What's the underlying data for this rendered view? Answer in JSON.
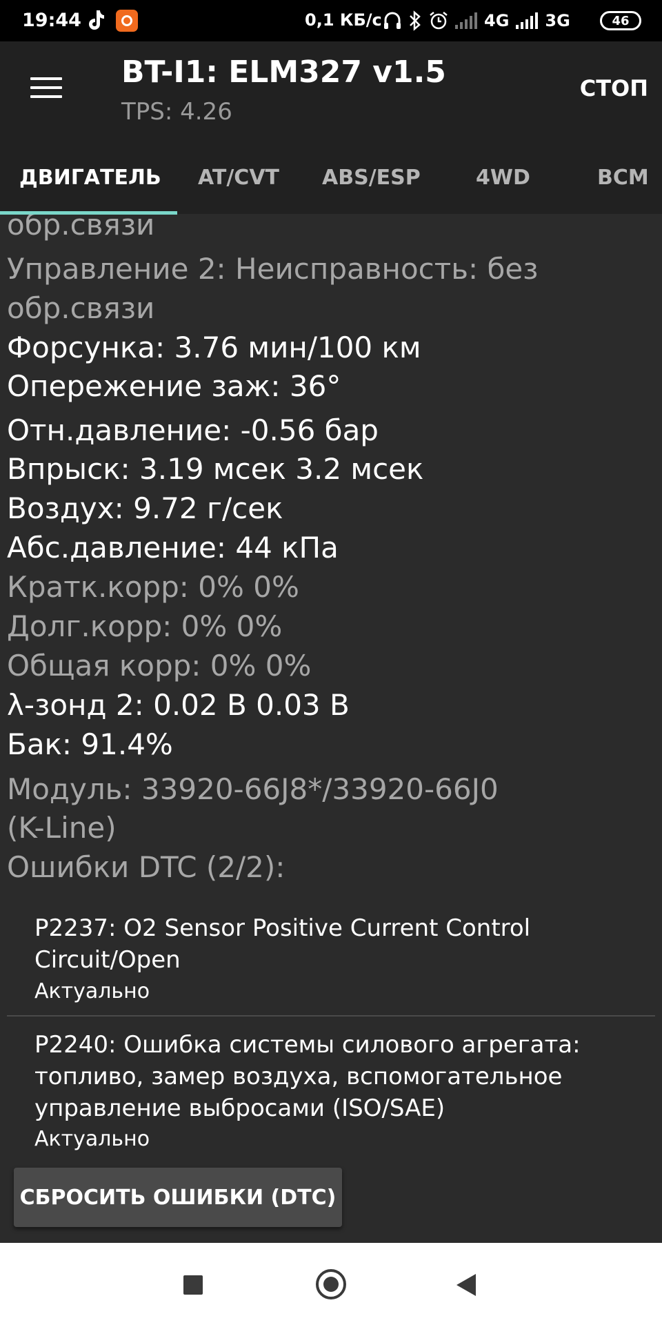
{
  "status_bar": {
    "time": "19:44",
    "speed": "0,1 КБ/с",
    "network_1": "4G",
    "network_2": "3G",
    "battery": "46",
    "icons": [
      "tiktok-icon",
      "app-notification-icon",
      "headphones-icon",
      "bluetooth-icon",
      "alarm-icon",
      "signal-icon"
    ]
  },
  "app_bar": {
    "title": "BT-I1: ELM327 v1.5",
    "subtitle": "TPS: 4.26",
    "stop_label": "СТОП"
  },
  "tabs": [
    {
      "label": "ДВИГАТЕЛЬ",
      "active": true
    },
    {
      "label": "AT/CVT",
      "active": false
    },
    {
      "label": "ABS/ESP",
      "active": false
    },
    {
      "label": "4WD",
      "active": false
    },
    {
      "label": "BCM",
      "active": false
    }
  ],
  "params": [
    {
      "text": "обр.связи",
      "style": "gray"
    },
    {
      "text": "Управление 2: Неисправность: без",
      "style": "gray"
    },
    {
      "text": "обр.связи",
      "style": "gray"
    },
    {
      "text": "Форсунка: 3.76 мин/100 км",
      "style": "white"
    },
    {
      "text": "Опережение заж: 36°",
      "style": "white"
    },
    {
      "text": "Отн.давление: -0.56 бар",
      "style": "white"
    },
    {
      "text": "Впрыск: 3.19 мсек  3.2 мсек",
      "style": "white"
    },
    {
      "text": "Воздух: 9.72 г/сек",
      "style": "white"
    },
    {
      "text": "Абс.давление: 44 кПа",
      "style": "white"
    },
    {
      "text": "Кратк.корр: 0%  0%",
      "style": "gray"
    },
    {
      "text": "Долг.корр: 0%  0%",
      "style": "gray"
    },
    {
      "text": "Общая корр: 0%  0%",
      "style": "gray"
    },
    {
      "text": "λ-зонд 2: 0.02 В  0.03 В",
      "style": "white"
    },
    {
      "text": "Бак: 91.4%",
      "style": "white"
    },
    {
      "text": "Модуль: 33920-66J8*/33920-66J0",
      "style": "gray"
    },
    {
      "text": "(K-Line)",
      "style": "gray"
    },
    {
      "text": "Ошибки DTC (2/2):",
      "style": "gray"
    }
  ],
  "dtc": [
    {
      "lines": [
        "P2237: O2 Sensor Positive Current Control",
        "Circuit/Open"
      ],
      "status": "Актуально"
    },
    {
      "lines": [
        "P2240: Ошибка системы силового агрегата:",
        "топливо, замер воздуха, вспомогательное",
        "управление выбросами (ISO/SAE)"
      ],
      "status": "Актуально"
    }
  ],
  "reset_button": "СБРОСИТЬ ОШИБКИ (DTC)",
  "nav_bar": {
    "icons": [
      "recents-icon",
      "home-icon",
      "back-icon"
    ]
  }
}
